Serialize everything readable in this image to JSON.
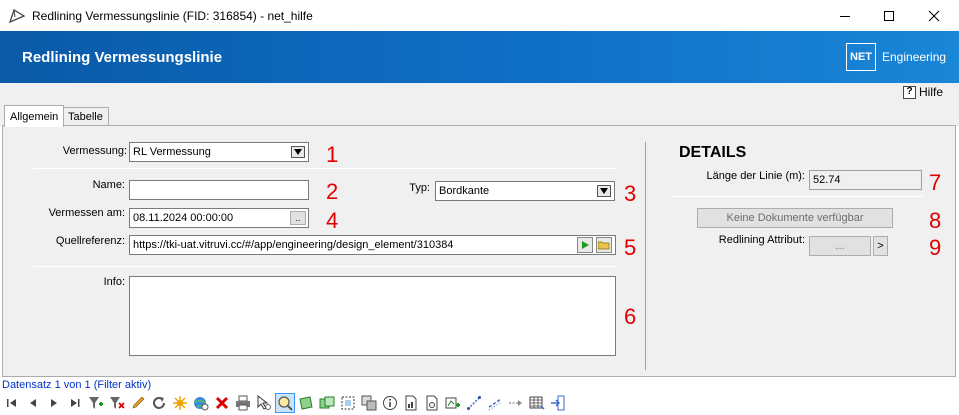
{
  "window": {
    "title": "Redlining Vermessungslinie (FID: 316854) - net_hilfe"
  },
  "header": {
    "title": "Redlining Vermessungslinie",
    "logo_box": "NET",
    "logo_text": "Engineering"
  },
  "help": {
    "label": "Hilfe"
  },
  "tabs": [
    {
      "label": "Allgemein",
      "active": true
    },
    {
      "label": "Tabelle",
      "active": false
    }
  ],
  "form": {
    "vermessung": {
      "label": "Vermessung:",
      "value": "RL Vermessung",
      "marker": "1"
    },
    "name": {
      "label": "Name:",
      "value": "",
      "marker": "2"
    },
    "typ": {
      "label": "Typ:",
      "value": "Bordkante",
      "marker": "3"
    },
    "vermessen_am": {
      "label": "Vermessen am:",
      "value": "08.11.2024 00:00:00",
      "marker": "4",
      "button": ".."
    },
    "quellreferenz": {
      "label": "Quellreferenz:",
      "value": "https://tki-uat.vitruvi.cc/#/app/engineering/design_element/310384",
      "marker": "5"
    },
    "info": {
      "label": "Info:",
      "value": "",
      "marker": "6"
    }
  },
  "details": {
    "heading": "DETAILS",
    "laenge": {
      "label": "Länge der Linie (m):",
      "value": "52.74",
      "marker": "7"
    },
    "dokumente": {
      "label": "Keine Dokumente verfügbar",
      "marker": "8"
    },
    "attribut": {
      "label": "Redlining Attribut:",
      "button": "...",
      "arrow": ">",
      "marker": "9"
    }
  },
  "status": {
    "text": "Datensatz 1 von 1 (Filter aktiv)"
  },
  "colors": {
    "accent": "#0f6fc6",
    "marker": "#e00000",
    "status": "#0033cc"
  },
  "toolbar_icons": [
    "first-record-icon",
    "prev-record-icon",
    "next-record-icon",
    "last-record-icon",
    "filter-add-icon",
    "filter-remove-icon",
    "edit-pencil-icon",
    "refresh-icon",
    "highlight-star-icon",
    "globe-link-icon",
    "delete-icon",
    "print-icon",
    "select-cursor-icon",
    "zoom-to-icon",
    "shape-green-icon",
    "shape-multi-icon",
    "select-rect-icon",
    "copy-shape-icon",
    "info-icon",
    "report-icon",
    "document-icon",
    "add-feature-icon",
    "line-tool-icon",
    "line-dash-icon",
    "move-arrow-icon",
    "table-icon",
    "exit-icon"
  ]
}
